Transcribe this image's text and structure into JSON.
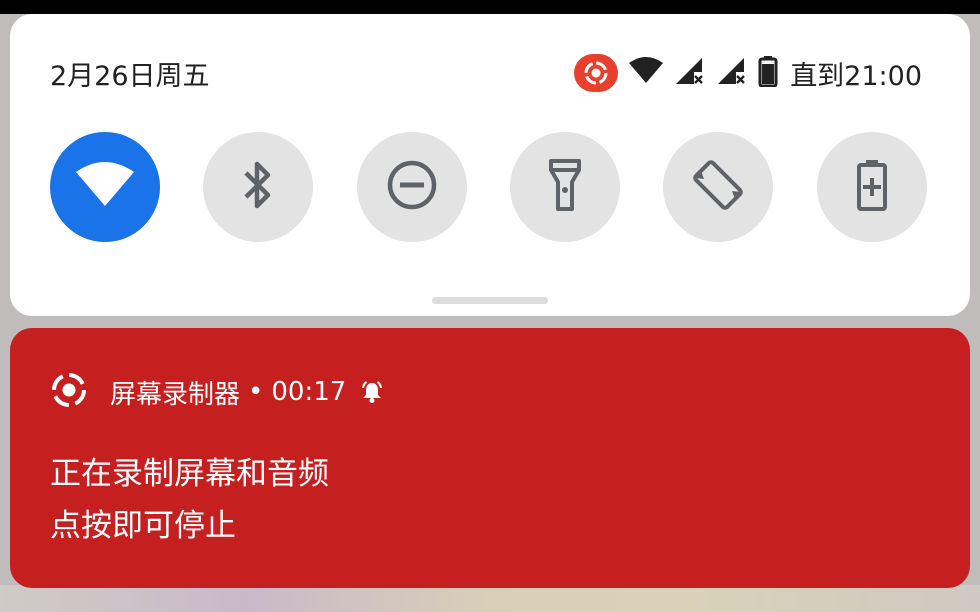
{
  "quick_settings": {
    "date": "2月26日周五",
    "status": {
      "battery_text": "直到21:00",
      "icons": [
        "screen-record-icon",
        "wifi-icon",
        "signal-icon",
        "signal-icon",
        "battery-icon"
      ]
    },
    "tiles": [
      {
        "name": "wifi",
        "icon": "wifi-icon",
        "active": true
      },
      {
        "name": "bluetooth",
        "icon": "bluetooth-icon",
        "active": false
      },
      {
        "name": "do-not-disturb",
        "icon": "do-not-disturb-icon",
        "active": false
      },
      {
        "name": "flashlight",
        "icon": "flashlight-icon",
        "active": false
      },
      {
        "name": "auto-rotate",
        "icon": "auto-rotate-icon",
        "active": false
      },
      {
        "name": "battery-saver",
        "icon": "battery-saver-icon",
        "active": false
      }
    ],
    "colors": {
      "active_tile": "#1a73e8",
      "inactive_tile": "#e3e3e3",
      "icon": "#5f6368"
    }
  },
  "notification": {
    "app_name": "屏幕录制器",
    "separator": "•",
    "time": "00:17",
    "title": "正在录制屏幕和音频",
    "text": "点按即可停止",
    "color": "#c51f20"
  }
}
